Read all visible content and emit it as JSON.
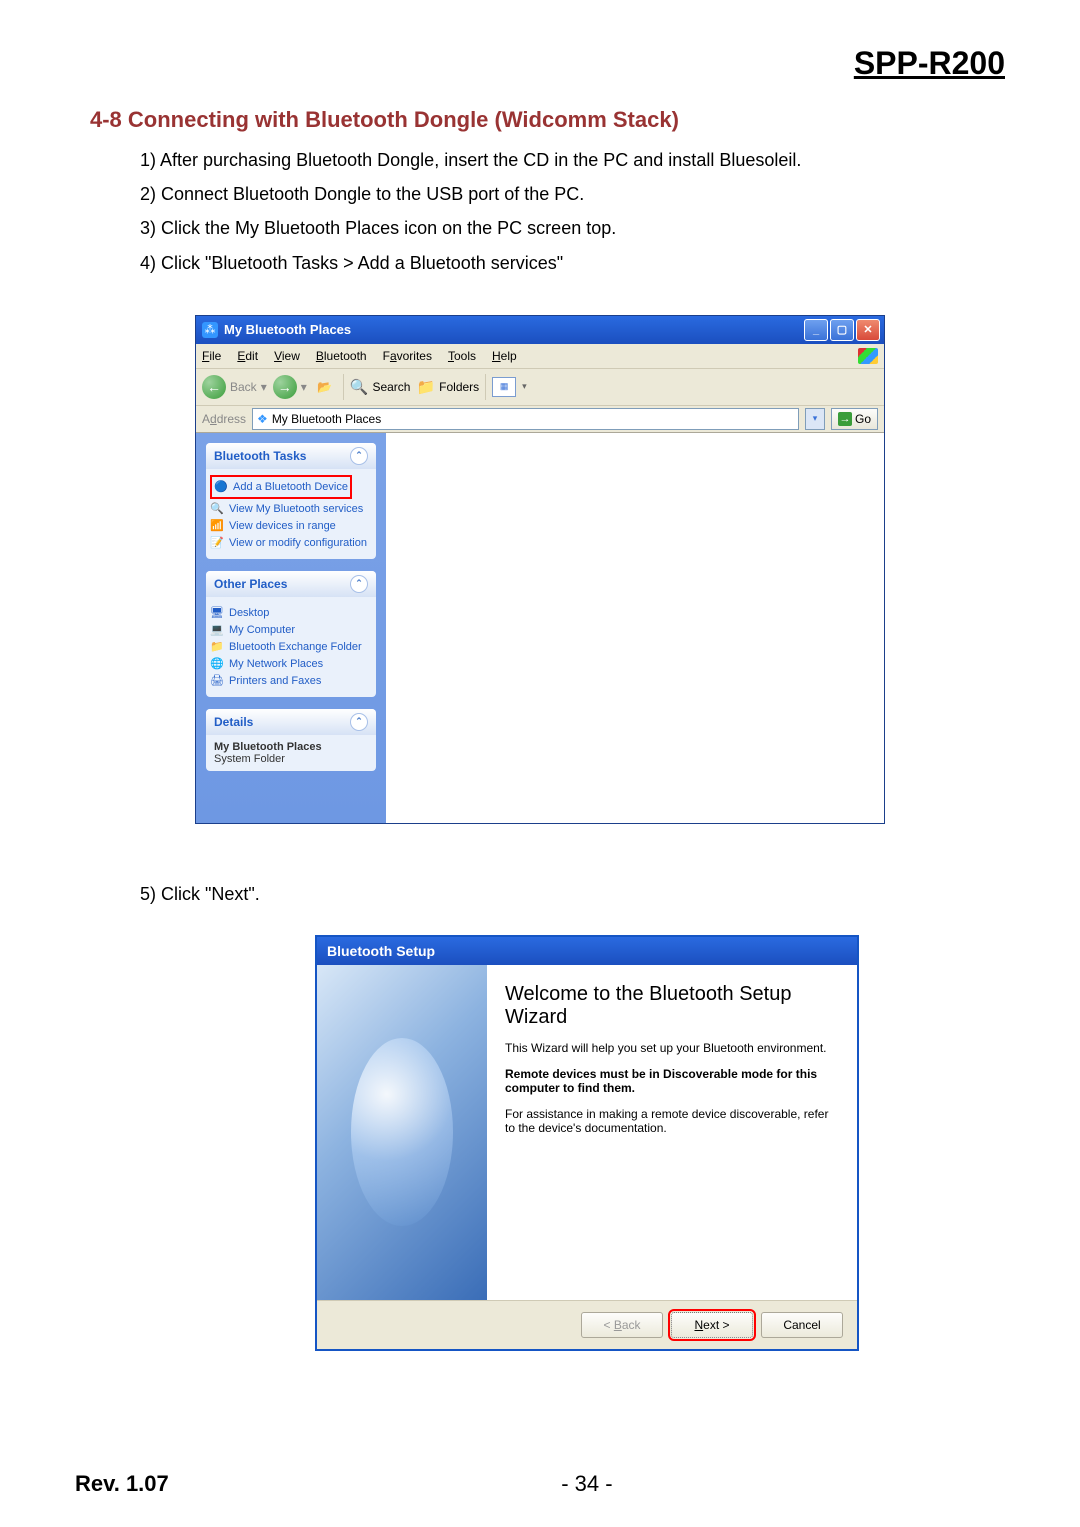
{
  "doc": {
    "product": "SPP-R200",
    "section_title": "4-8 Connecting with Bluetooth Dongle (Widcomm Stack)",
    "steps": [
      "1) After purchasing Bluetooth Dongle, insert the CD in the PC and install Bluesoleil.",
      "2) Connect Bluetooth Dongle to the USB port of the PC.",
      "3) Click the My Bluetooth Places icon on the PC screen top.",
      "4) Click \"Bluetooth Tasks > Add a Bluetooth services\""
    ],
    "step5": "5) Click \"Next\".",
    "rev": "Rev. 1.07",
    "page": "- 34 -"
  },
  "explorer": {
    "title": "My Bluetooth Places",
    "menu": {
      "file": "File",
      "edit": "Edit",
      "view": "View",
      "bluetooth": "Bluetooth",
      "favorites": "Favorites",
      "tools": "Tools",
      "help": "Help"
    },
    "toolbar": {
      "back": "Back",
      "search": "Search",
      "folders": "Folders"
    },
    "address": {
      "label": "Address",
      "value": "My Bluetooth Places",
      "go": "Go"
    },
    "panels": {
      "tasks": {
        "head": "Bluetooth Tasks",
        "items": [
          {
            "icon": "🔵",
            "label": "Add a Bluetooth Device",
            "hl": true
          },
          {
            "icon": "🔍",
            "label": "View My Bluetooth services"
          },
          {
            "icon": "📶",
            "label": "View devices in range"
          },
          {
            "icon": "📝",
            "label": "View or modify configuration"
          }
        ]
      },
      "other": {
        "head": "Other Places",
        "items": [
          {
            "icon": "🖥",
            "label": "Desktop"
          },
          {
            "icon": "💻",
            "label": "My Computer"
          },
          {
            "icon": "📁",
            "label": "Bluetooth Exchange Folder"
          },
          {
            "icon": "🌐",
            "label": "My Network Places"
          },
          {
            "icon": "🖨",
            "label": "Printers and Faxes"
          }
        ]
      },
      "details": {
        "head": "Details",
        "name": "My Bluetooth Places",
        "type": "System Folder"
      }
    }
  },
  "wizard": {
    "title": "Bluetooth Setup",
    "heading": "Welcome to the Bluetooth Setup Wizard",
    "line1": "This Wizard will help you set up your Bluetooth environment.",
    "line2": "Remote devices must be in Discoverable mode for this computer to find them.",
    "line3": "For assistance in making a remote device discoverable, refer to the device's documentation.",
    "buttons": {
      "back": "< Back",
      "next": "Next >",
      "cancel": "Cancel"
    }
  }
}
